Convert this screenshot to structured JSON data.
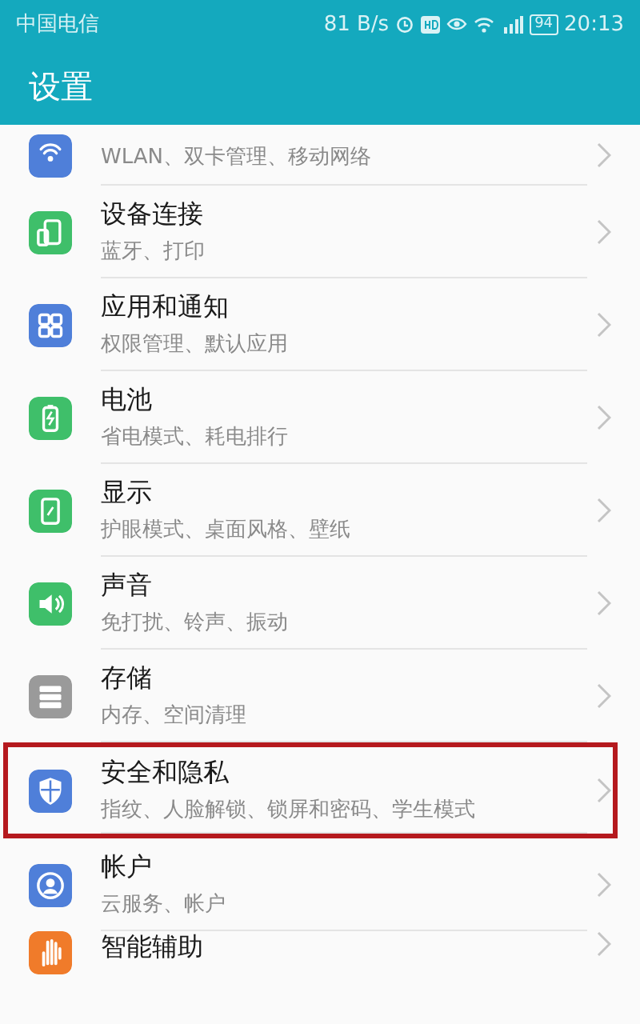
{
  "status_bar": {
    "carrier": "中国电信",
    "speed": "81 B/s",
    "battery": "94",
    "time": "20:13"
  },
  "app_bar": {
    "title": "设置"
  },
  "items": [
    {
      "kind": "wifi",
      "subtitle": "WLAN、双卡管理、移动网络",
      "color": "#4f7fd9",
      "highlighted": false
    },
    {
      "kind": "device",
      "title": "设备连接",
      "subtitle": "蓝牙、打印",
      "color": "#3fbf6a",
      "highlighted": false
    },
    {
      "kind": "apps",
      "title": "应用和通知",
      "subtitle": "权限管理、默认应用",
      "color": "#4f7fd9",
      "highlighted": false
    },
    {
      "kind": "battery",
      "title": "电池",
      "subtitle": "省电模式、耗电排行",
      "color": "#3fbf6a",
      "highlighted": false
    },
    {
      "kind": "display",
      "title": "显示",
      "subtitle": "护眼模式、桌面风格、壁纸",
      "color": "#3fbf6a",
      "highlighted": false
    },
    {
      "kind": "sound",
      "title": "声音",
      "subtitle": "免打扰、铃声、振动",
      "color": "#3fbf6a",
      "highlighted": false
    },
    {
      "kind": "storage",
      "title": "存储",
      "subtitle": "内存、空间清理",
      "color": "#9a9a9a",
      "highlighted": false
    },
    {
      "kind": "shield",
      "title": "安全和隐私",
      "subtitle": "指纹、人脸解锁、锁屏和密码、学生模式",
      "color": "#4f7fd9",
      "highlighted": true
    },
    {
      "kind": "account",
      "title": "帐户",
      "subtitle": "云服务、帐户",
      "color": "#4f7fd9",
      "highlighted": false
    },
    {
      "kind": "hand",
      "title": "智能辅助",
      "color": "#f07b2a",
      "highlighted": false
    }
  ]
}
